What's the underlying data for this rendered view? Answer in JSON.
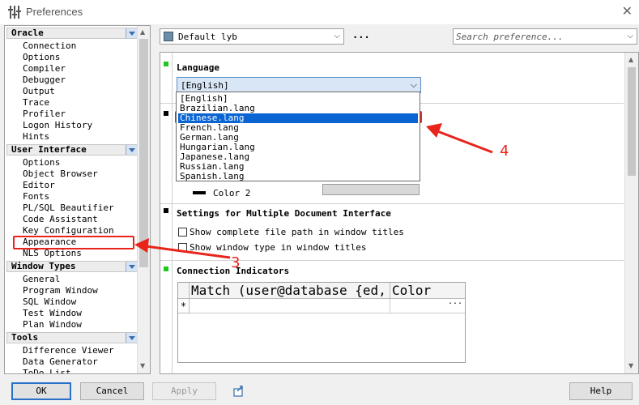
{
  "window": {
    "title": "Preferences"
  },
  "tree": {
    "groups": [
      {
        "label": "Oracle",
        "items": [
          "Connection",
          "Options",
          "Compiler",
          "Debugger",
          "Output",
          "Trace",
          "Profiler",
          "Logon History",
          "Hints"
        ]
      },
      {
        "label": "User Interface",
        "items": [
          "Options",
          "Object Browser",
          "Editor",
          "Fonts",
          "PL/SQL Beautifier",
          "Code Assistant",
          "Key Configuration",
          "Appearance",
          "NLS Options"
        ]
      },
      {
        "label": "Window Types",
        "items": [
          "General",
          "Program Window",
          "SQL Window",
          "Test Window",
          "Plan Window"
        ]
      },
      {
        "label": "Tools",
        "items": [
          "Difference Viewer",
          "Data Generator",
          "ToDo List"
        ]
      }
    ],
    "selected": "Appearance"
  },
  "toolbar": {
    "profile_value": "Default lyb",
    "more_label": "...",
    "search_placeholder": "Search preference..."
  },
  "language": {
    "title": "Language",
    "selected": "[English]",
    "options": [
      "[English]",
      "Brazilian.lang",
      "Chinese.lang",
      "French.lang",
      "German.lang",
      "Hungarian.lang",
      "Japanese.lang",
      "Russian.lang",
      "Spanish.lang"
    ],
    "highlighted": "Chinese.lang"
  },
  "colors": {
    "color2_label": "Color 2"
  },
  "mdi": {
    "title": "Settings for Multiple Document Interface",
    "options": [
      {
        "label": "Show complete file path in window titles",
        "checked": false
      },
      {
        "label": "Show window type in window titles",
        "checked": false
      }
    ]
  },
  "connection": {
    "title": "Connection Indicators",
    "columns": [
      "Match (user@database {ed,",
      "Color"
    ],
    "new_row_marker": "*",
    "ellipsis": "..."
  },
  "buttons": {
    "ok": "OK",
    "cancel": "Cancel",
    "apply": "Apply",
    "help": "Help"
  },
  "annotations": {
    "step3": "3",
    "step4": "4"
  },
  "accent_colors": {
    "selection": "#0a64d2",
    "annotation": "#e8241b",
    "marker_green": "#1ec81e"
  }
}
